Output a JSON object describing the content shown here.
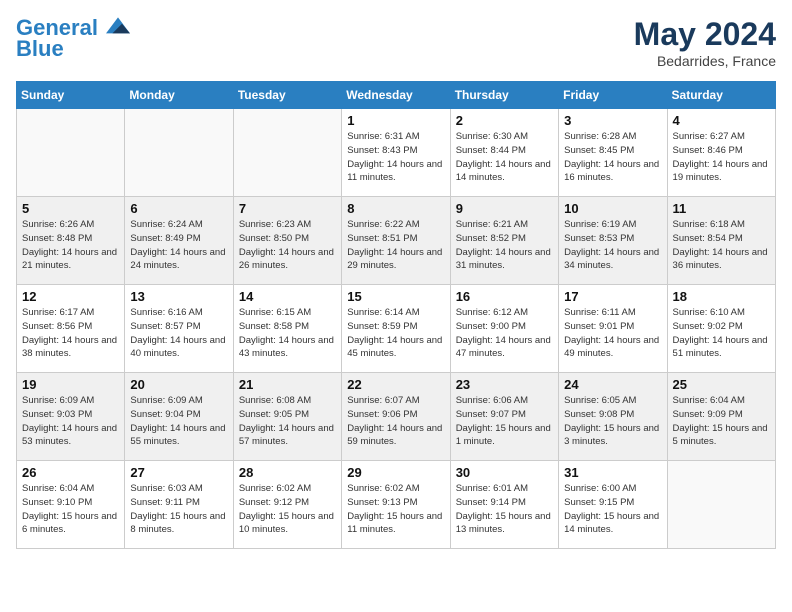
{
  "header": {
    "logo_line1": "General",
    "logo_line2": "Blue",
    "month_year": "May 2024",
    "location": "Bedarrides, France"
  },
  "weekdays": [
    "Sunday",
    "Monday",
    "Tuesday",
    "Wednesday",
    "Thursday",
    "Friday",
    "Saturday"
  ],
  "weeks": [
    [
      {
        "day": "",
        "info": "",
        "empty": true
      },
      {
        "day": "",
        "info": "",
        "empty": true
      },
      {
        "day": "",
        "info": "",
        "empty": true
      },
      {
        "day": "1",
        "info": "Sunrise: 6:31 AM\nSunset: 8:43 PM\nDaylight: 14 hours\nand 11 minutes.",
        "empty": false
      },
      {
        "day": "2",
        "info": "Sunrise: 6:30 AM\nSunset: 8:44 PM\nDaylight: 14 hours\nand 14 minutes.",
        "empty": false
      },
      {
        "day": "3",
        "info": "Sunrise: 6:28 AM\nSunset: 8:45 PM\nDaylight: 14 hours\nand 16 minutes.",
        "empty": false
      },
      {
        "day": "4",
        "info": "Sunrise: 6:27 AM\nSunset: 8:46 PM\nDaylight: 14 hours\nand 19 minutes.",
        "empty": false
      }
    ],
    [
      {
        "day": "5",
        "info": "Sunrise: 6:26 AM\nSunset: 8:48 PM\nDaylight: 14 hours\nand 21 minutes.",
        "empty": false
      },
      {
        "day": "6",
        "info": "Sunrise: 6:24 AM\nSunset: 8:49 PM\nDaylight: 14 hours\nand 24 minutes.",
        "empty": false
      },
      {
        "day": "7",
        "info": "Sunrise: 6:23 AM\nSunset: 8:50 PM\nDaylight: 14 hours\nand 26 minutes.",
        "empty": false
      },
      {
        "day": "8",
        "info": "Sunrise: 6:22 AM\nSunset: 8:51 PM\nDaylight: 14 hours\nand 29 minutes.",
        "empty": false
      },
      {
        "day": "9",
        "info": "Sunrise: 6:21 AM\nSunset: 8:52 PM\nDaylight: 14 hours\nand 31 minutes.",
        "empty": false
      },
      {
        "day": "10",
        "info": "Sunrise: 6:19 AM\nSunset: 8:53 PM\nDaylight: 14 hours\nand 34 minutes.",
        "empty": false
      },
      {
        "day": "11",
        "info": "Sunrise: 6:18 AM\nSunset: 8:54 PM\nDaylight: 14 hours\nand 36 minutes.",
        "empty": false
      }
    ],
    [
      {
        "day": "12",
        "info": "Sunrise: 6:17 AM\nSunset: 8:56 PM\nDaylight: 14 hours\nand 38 minutes.",
        "empty": false
      },
      {
        "day": "13",
        "info": "Sunrise: 6:16 AM\nSunset: 8:57 PM\nDaylight: 14 hours\nand 40 minutes.",
        "empty": false
      },
      {
        "day": "14",
        "info": "Sunrise: 6:15 AM\nSunset: 8:58 PM\nDaylight: 14 hours\nand 43 minutes.",
        "empty": false
      },
      {
        "day": "15",
        "info": "Sunrise: 6:14 AM\nSunset: 8:59 PM\nDaylight: 14 hours\nand 45 minutes.",
        "empty": false
      },
      {
        "day": "16",
        "info": "Sunrise: 6:12 AM\nSunset: 9:00 PM\nDaylight: 14 hours\nand 47 minutes.",
        "empty": false
      },
      {
        "day": "17",
        "info": "Sunrise: 6:11 AM\nSunset: 9:01 PM\nDaylight: 14 hours\nand 49 minutes.",
        "empty": false
      },
      {
        "day": "18",
        "info": "Sunrise: 6:10 AM\nSunset: 9:02 PM\nDaylight: 14 hours\nand 51 minutes.",
        "empty": false
      }
    ],
    [
      {
        "day": "19",
        "info": "Sunrise: 6:09 AM\nSunset: 9:03 PM\nDaylight: 14 hours\nand 53 minutes.",
        "empty": false
      },
      {
        "day": "20",
        "info": "Sunrise: 6:09 AM\nSunset: 9:04 PM\nDaylight: 14 hours\nand 55 minutes.",
        "empty": false
      },
      {
        "day": "21",
        "info": "Sunrise: 6:08 AM\nSunset: 9:05 PM\nDaylight: 14 hours\nand 57 minutes.",
        "empty": false
      },
      {
        "day": "22",
        "info": "Sunrise: 6:07 AM\nSunset: 9:06 PM\nDaylight: 14 hours\nand 59 minutes.",
        "empty": false
      },
      {
        "day": "23",
        "info": "Sunrise: 6:06 AM\nSunset: 9:07 PM\nDaylight: 15 hours\nand 1 minute.",
        "empty": false
      },
      {
        "day": "24",
        "info": "Sunrise: 6:05 AM\nSunset: 9:08 PM\nDaylight: 15 hours\nand 3 minutes.",
        "empty": false
      },
      {
        "day": "25",
        "info": "Sunrise: 6:04 AM\nSunset: 9:09 PM\nDaylight: 15 hours\nand 5 minutes.",
        "empty": false
      }
    ],
    [
      {
        "day": "26",
        "info": "Sunrise: 6:04 AM\nSunset: 9:10 PM\nDaylight: 15 hours\nand 6 minutes.",
        "empty": false
      },
      {
        "day": "27",
        "info": "Sunrise: 6:03 AM\nSunset: 9:11 PM\nDaylight: 15 hours\nand 8 minutes.",
        "empty": false
      },
      {
        "day": "28",
        "info": "Sunrise: 6:02 AM\nSunset: 9:12 PM\nDaylight: 15 hours\nand 10 minutes.",
        "empty": false
      },
      {
        "day": "29",
        "info": "Sunrise: 6:02 AM\nSunset: 9:13 PM\nDaylight: 15 hours\nand 11 minutes.",
        "empty": false
      },
      {
        "day": "30",
        "info": "Sunrise: 6:01 AM\nSunset: 9:14 PM\nDaylight: 15 hours\nand 13 minutes.",
        "empty": false
      },
      {
        "day": "31",
        "info": "Sunrise: 6:00 AM\nSunset: 9:15 PM\nDaylight: 15 hours\nand 14 minutes.",
        "empty": false
      },
      {
        "day": "",
        "info": "",
        "empty": true
      }
    ]
  ]
}
